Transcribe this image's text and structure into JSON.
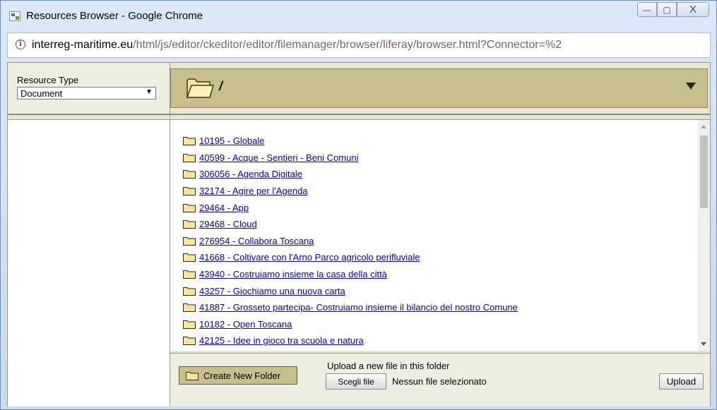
{
  "window": {
    "title": "Resources Browser - Google Chrome",
    "minimize_glyph": "—",
    "maximize_glyph": "▢",
    "close_glyph": "X"
  },
  "address": {
    "info_glyph": "i",
    "host": "interreg-maritime.eu",
    "path": "/html/js/editor/ckeditor/editor/filemanager/browser/liferay/browser.html?Connector=%2"
  },
  "sidebar": {
    "resource_type_label": "Resource Type",
    "resource_type_value": "Document"
  },
  "toolbar": {
    "current_path": "/"
  },
  "folders": [
    "10195 - Globale",
    "40599 - Acque - Sentieri - Beni Comuni",
    "306056 - Agenda Digitale",
    "32174 - Agire per l'Agenda",
    "29464 - App",
    "29468 - Cloud",
    "276954 - Collabora Toscana",
    "41668 - Coltivare con l'Arno Parco agricolo perifluviale",
    "43940 - Costruiamo insieme la casa della città",
    "43257 - Giochiamo una nuova carta",
    "41887 - Grosseto partecipa- Costruiamo insieme il bilancio del nostro Comune",
    "10182 - Open Toscana",
    "42125 - Idee in gioco tra scuola e natura"
  ],
  "footer": {
    "create_folder_label": "Create New Folder",
    "upload_label": "Upload a new file in this folder",
    "choose_file_label": "Scegli file",
    "no_file_label": "Nessun file selezionato",
    "upload_button_label": "Upload"
  },
  "colors": {
    "panel_bg": "#e8e6d6",
    "path_bar": "#c7c08c",
    "link": "#0000cc",
    "folder_fill": "#f7e59a"
  }
}
